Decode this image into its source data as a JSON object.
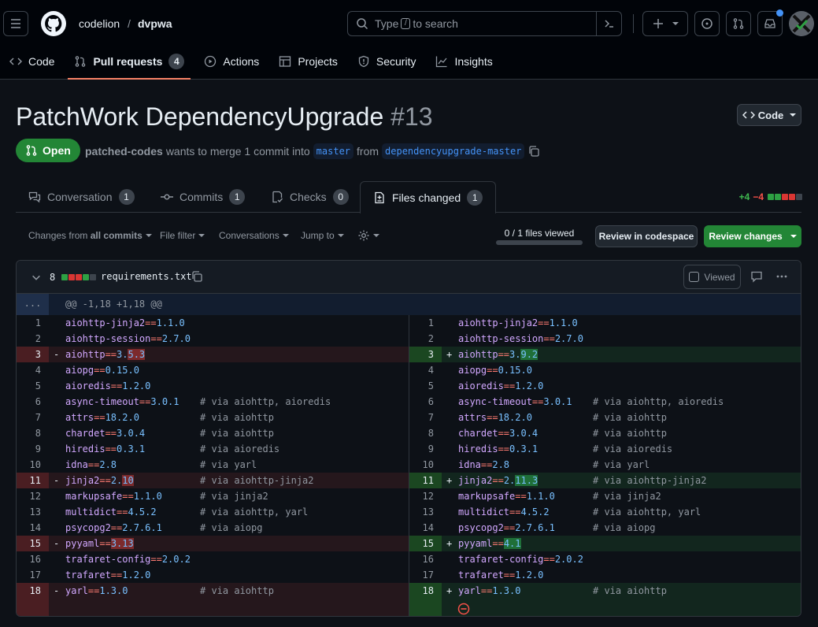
{
  "repo": {
    "owner": "codelion",
    "sep": "/",
    "name": "dvpwa"
  },
  "search": {
    "pre": "Type",
    "key": "/",
    "post": "to search"
  },
  "nav": [
    {
      "label": "Code"
    },
    {
      "label": "Pull requests",
      "count": "4"
    },
    {
      "label": "Actions"
    },
    {
      "label": "Projects"
    },
    {
      "label": "Security"
    },
    {
      "label": "Insights"
    }
  ],
  "pr": {
    "title": "PatchWork DependencyUpgrade",
    "number": "#13",
    "state": "Open",
    "author": "patched-codes",
    "meta_text": "wants to merge 1 commit into",
    "base": "master",
    "from": "from",
    "head": "dependencyupgrade-master",
    "code_button": "Code"
  },
  "tabs": [
    {
      "label": "Conversation",
      "count": "1"
    },
    {
      "label": "Commits",
      "count": "1"
    },
    {
      "label": "Checks",
      "count": "0"
    },
    {
      "label": "Files changed",
      "count": "1"
    }
  ],
  "diffstat": {
    "added": "+4",
    "removed": "−4"
  },
  "toolbar": {
    "changes_from": "Changes from",
    "all_commits": "all commits",
    "file_filter": "File filter",
    "conversations": "Conversations",
    "jump_to": "Jump to",
    "files_viewed": "0 / 1 files viewed",
    "files_viewed_fraction": 0,
    "review_codespace": "Review in codespace",
    "review_changes": "Review changes"
  },
  "file": {
    "count": "8",
    "name": "requirements.txt",
    "viewed_label": "Viewed",
    "expand": "...",
    "hunk": "@@ -1,18 +1,18 @@"
  },
  "colors": {
    "accent": "#f78166",
    "open": "#238636",
    "link": "#4493f8",
    "added": "#3fb950",
    "removed": "#f85149"
  },
  "diff": {
    "left": [
      {
        "ln": "1",
        "mark": "",
        "pkg": "aiohttp-jinja2",
        "op": "==",
        "ver": "1.1.0",
        "hl": "",
        "comment": "",
        "type": "ctx"
      },
      {
        "ln": "2",
        "mark": "",
        "pkg": "aiohttp-session",
        "op": "==",
        "ver": "2.7.0",
        "hl": "",
        "comment": "",
        "type": "ctx"
      },
      {
        "ln": "3",
        "mark": "-",
        "pkg": "aiohttp",
        "op": "==",
        "ver": "3.",
        "hl": "5.3",
        "comment": "",
        "type": "del"
      },
      {
        "ln": "4",
        "mark": "",
        "pkg": "aiopg",
        "op": "==",
        "ver": "0.15.0",
        "hl": "",
        "comment": "",
        "type": "ctx"
      },
      {
        "ln": "5",
        "mark": "",
        "pkg": "aioredis",
        "op": "==",
        "ver": "1.2.0",
        "hl": "",
        "comment": "",
        "type": "ctx"
      },
      {
        "ln": "6",
        "mark": "",
        "pkg": "async-timeout",
        "op": "==",
        "ver": "3.0.1",
        "hl": "",
        "comment": "# via aiohttp, aioredis",
        "type": "ctx"
      },
      {
        "ln": "7",
        "mark": "",
        "pkg": "attrs",
        "op": "==",
        "ver": "18.2.0",
        "hl": "",
        "comment": "# via aiohttp",
        "type": "ctx"
      },
      {
        "ln": "8",
        "mark": "",
        "pkg": "chardet",
        "op": "==",
        "ver": "3.0.4",
        "hl": "",
        "comment": "# via aiohttp",
        "type": "ctx"
      },
      {
        "ln": "9",
        "mark": "",
        "pkg": "hiredis",
        "op": "==",
        "ver": "0.3.1",
        "hl": "",
        "comment": "# via aioredis",
        "type": "ctx"
      },
      {
        "ln": "10",
        "mark": "",
        "pkg": "idna",
        "op": "==",
        "ver": "2.8",
        "hl": "",
        "comment": "# via yarl",
        "type": "ctx"
      },
      {
        "ln": "11",
        "mark": "-",
        "pkg": "jinja2",
        "op": "==",
        "ver": "2.",
        "hl": "10",
        "comment": "# via aiohttp-jinja2",
        "type": "del"
      },
      {
        "ln": "12",
        "mark": "",
        "pkg": "markupsafe",
        "op": "==",
        "ver": "1.1.0",
        "hl": "",
        "comment": "# via jinja2",
        "type": "ctx"
      },
      {
        "ln": "13",
        "mark": "",
        "pkg": "multidict",
        "op": "==",
        "ver": "4.5.2",
        "hl": "",
        "comment": "# via aiohttp, yarl",
        "type": "ctx"
      },
      {
        "ln": "14",
        "mark": "",
        "pkg": "psycopg2",
        "op": "==",
        "ver": "2.7.6.1",
        "hl": "",
        "comment": "# via aiopg",
        "type": "ctx"
      },
      {
        "ln": "15",
        "mark": "-",
        "pkg": "pyyaml",
        "op": "==",
        "ver": "",
        "hl": "3.13",
        "comment": "",
        "type": "del"
      },
      {
        "ln": "16",
        "mark": "",
        "pkg": "trafaret-config",
        "op": "==",
        "ver": "2.0.2",
        "hl": "",
        "comment": "",
        "type": "ctx"
      },
      {
        "ln": "17",
        "mark": "",
        "pkg": "trafaret",
        "op": "==",
        "ver": "1.2.0",
        "hl": "",
        "comment": "",
        "type": "ctx"
      },
      {
        "ln": "18",
        "mark": "-",
        "pkg": "yarl",
        "op": "==",
        "ver": "1.3.0",
        "hl": "",
        "comment": "# via aiohttp",
        "type": "del"
      }
    ],
    "right": [
      {
        "ln": "1",
        "mark": "",
        "pkg": "aiohttp-jinja2",
        "op": "==",
        "ver": "1.1.0",
        "hl": "",
        "comment": "",
        "type": "ctx"
      },
      {
        "ln": "2",
        "mark": "",
        "pkg": "aiohttp-session",
        "op": "==",
        "ver": "2.7.0",
        "hl": "",
        "comment": "",
        "type": "ctx"
      },
      {
        "ln": "3",
        "mark": "+",
        "pkg": "aiohttp",
        "op": "==",
        "ver": "3.",
        "hl": "9.2",
        "comment": "",
        "type": "add"
      },
      {
        "ln": "4",
        "mark": "",
        "pkg": "aiopg",
        "op": "==",
        "ver": "0.15.0",
        "hl": "",
        "comment": "",
        "type": "ctx"
      },
      {
        "ln": "5",
        "mark": "",
        "pkg": "aioredis",
        "op": "==",
        "ver": "1.2.0",
        "hl": "",
        "comment": "",
        "type": "ctx"
      },
      {
        "ln": "6",
        "mark": "",
        "pkg": "async-timeout",
        "op": "==",
        "ver": "3.0.1",
        "hl": "",
        "comment": "# via aiohttp, aioredis",
        "type": "ctx"
      },
      {
        "ln": "7",
        "mark": "",
        "pkg": "attrs",
        "op": "==",
        "ver": "18.2.0",
        "hl": "",
        "comment": "# via aiohttp",
        "type": "ctx"
      },
      {
        "ln": "8",
        "mark": "",
        "pkg": "chardet",
        "op": "==",
        "ver": "3.0.4",
        "hl": "",
        "comment": "# via aiohttp",
        "type": "ctx"
      },
      {
        "ln": "9",
        "mark": "",
        "pkg": "hiredis",
        "op": "==",
        "ver": "0.3.1",
        "hl": "",
        "comment": "# via aioredis",
        "type": "ctx"
      },
      {
        "ln": "10",
        "mark": "",
        "pkg": "idna",
        "op": "==",
        "ver": "2.8",
        "hl": "",
        "comment": "# via yarl",
        "type": "ctx"
      },
      {
        "ln": "11",
        "mark": "+",
        "pkg": "jinja2",
        "op": "==",
        "ver": "2.",
        "hl": "11.3",
        "comment": "# via aiohttp-jinja2",
        "type": "add"
      },
      {
        "ln": "12",
        "mark": "",
        "pkg": "markupsafe",
        "op": "==",
        "ver": "1.1.0",
        "hl": "",
        "comment": "# via jinja2",
        "type": "ctx"
      },
      {
        "ln": "13",
        "mark": "",
        "pkg": "multidict",
        "op": "==",
        "ver": "4.5.2",
        "hl": "",
        "comment": "# via aiohttp, yarl",
        "type": "ctx"
      },
      {
        "ln": "14",
        "mark": "",
        "pkg": "psycopg2",
        "op": "==",
        "ver": "2.7.6.1",
        "hl": "",
        "comment": "# via aiopg",
        "type": "ctx"
      },
      {
        "ln": "15",
        "mark": "+",
        "pkg": "pyyaml",
        "op": "==",
        "ver": "",
        "hl": "4.1",
        "comment": "",
        "type": "add"
      },
      {
        "ln": "16",
        "mark": "",
        "pkg": "trafaret-config",
        "op": "==",
        "ver": "2.0.2",
        "hl": "",
        "comment": "",
        "type": "ctx"
      },
      {
        "ln": "17",
        "mark": "",
        "pkg": "trafaret",
        "op": "==",
        "ver": "1.2.0",
        "hl": "",
        "comment": "",
        "type": "ctx"
      },
      {
        "ln": "18",
        "mark": "+",
        "pkg": "yarl",
        "op": "==",
        "ver": "1.3.0",
        "hl": "",
        "comment": "# via aiohttp",
        "type": "add"
      }
    ]
  }
}
